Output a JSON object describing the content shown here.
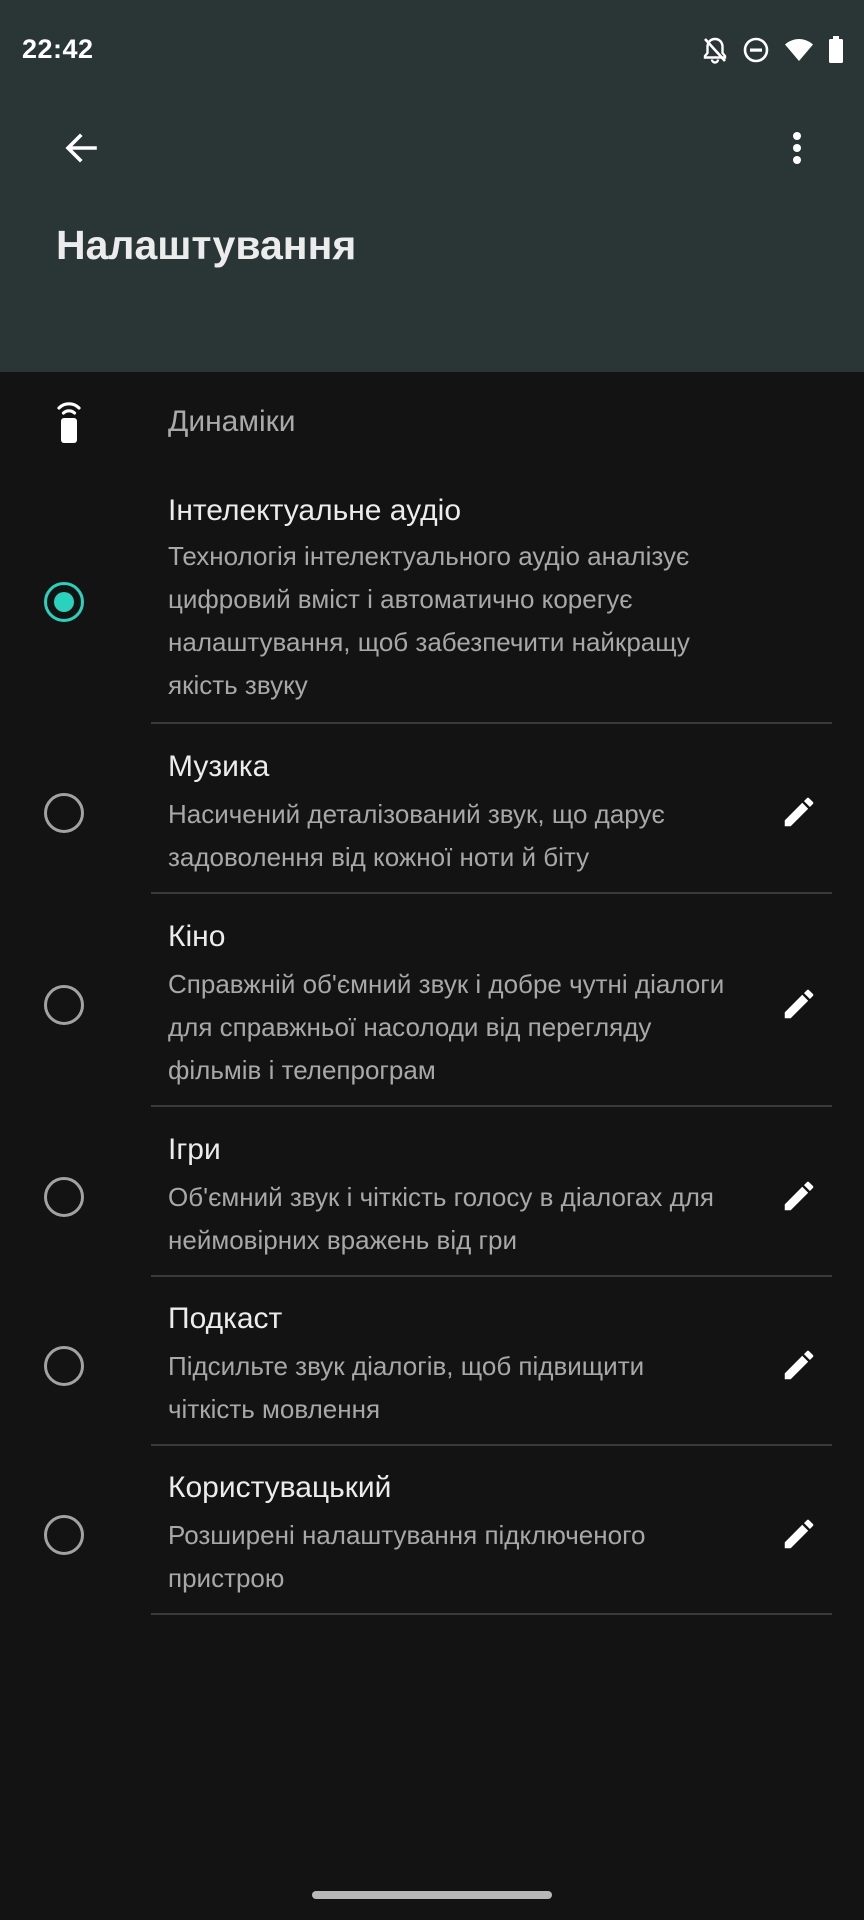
{
  "status_bar": {
    "time": "22:42",
    "icons": [
      "notifications-off-icon",
      "do-not-disturb-icon",
      "wifi-icon",
      "battery-icon"
    ]
  },
  "app_bar": {
    "title": "Налаштування",
    "back_icon": "arrow-back-icon",
    "menu_icon": "more-vertical-icon"
  },
  "section": {
    "icon": "speaker-icon",
    "title": "Динаміки"
  },
  "options": [
    {
      "title": "Інтелектуальне аудіо",
      "description": "Технологія інтелектуального аудіо аналізує цифровий вміст і автоматично корегує налаштування, щоб забезпечити найкращу якість звуку",
      "selected": true,
      "editable": false
    },
    {
      "title": "Музика",
      "description": "Насичений деталізований звук, що дарує задоволення від кожної ноти й біту",
      "selected": false,
      "editable": true
    },
    {
      "title": "Кіно",
      "description": "Справжній об'ємний звук і добре чутні діалоги для справжньої насолоди від перегляду фільмів і телепрограм",
      "selected": false,
      "editable": true
    },
    {
      "title": "Ігри",
      "description": "Об'ємний звук і чіткість голосу в діалогах для неймовірних вражень від гри",
      "selected": false,
      "editable": true
    },
    {
      "title": "Подкаст",
      "description": "Підсильте звук діалогів, щоб підвищити чіткість мовлення",
      "selected": false,
      "editable": true
    },
    {
      "title": "Користувацький",
      "description": "Розширені налаштування підключеного пристрою",
      "selected": false,
      "editable": true
    }
  ],
  "colors": {
    "header_bg": "#2a3535",
    "body_bg": "#131313",
    "accent": "#2ad1bd"
  }
}
